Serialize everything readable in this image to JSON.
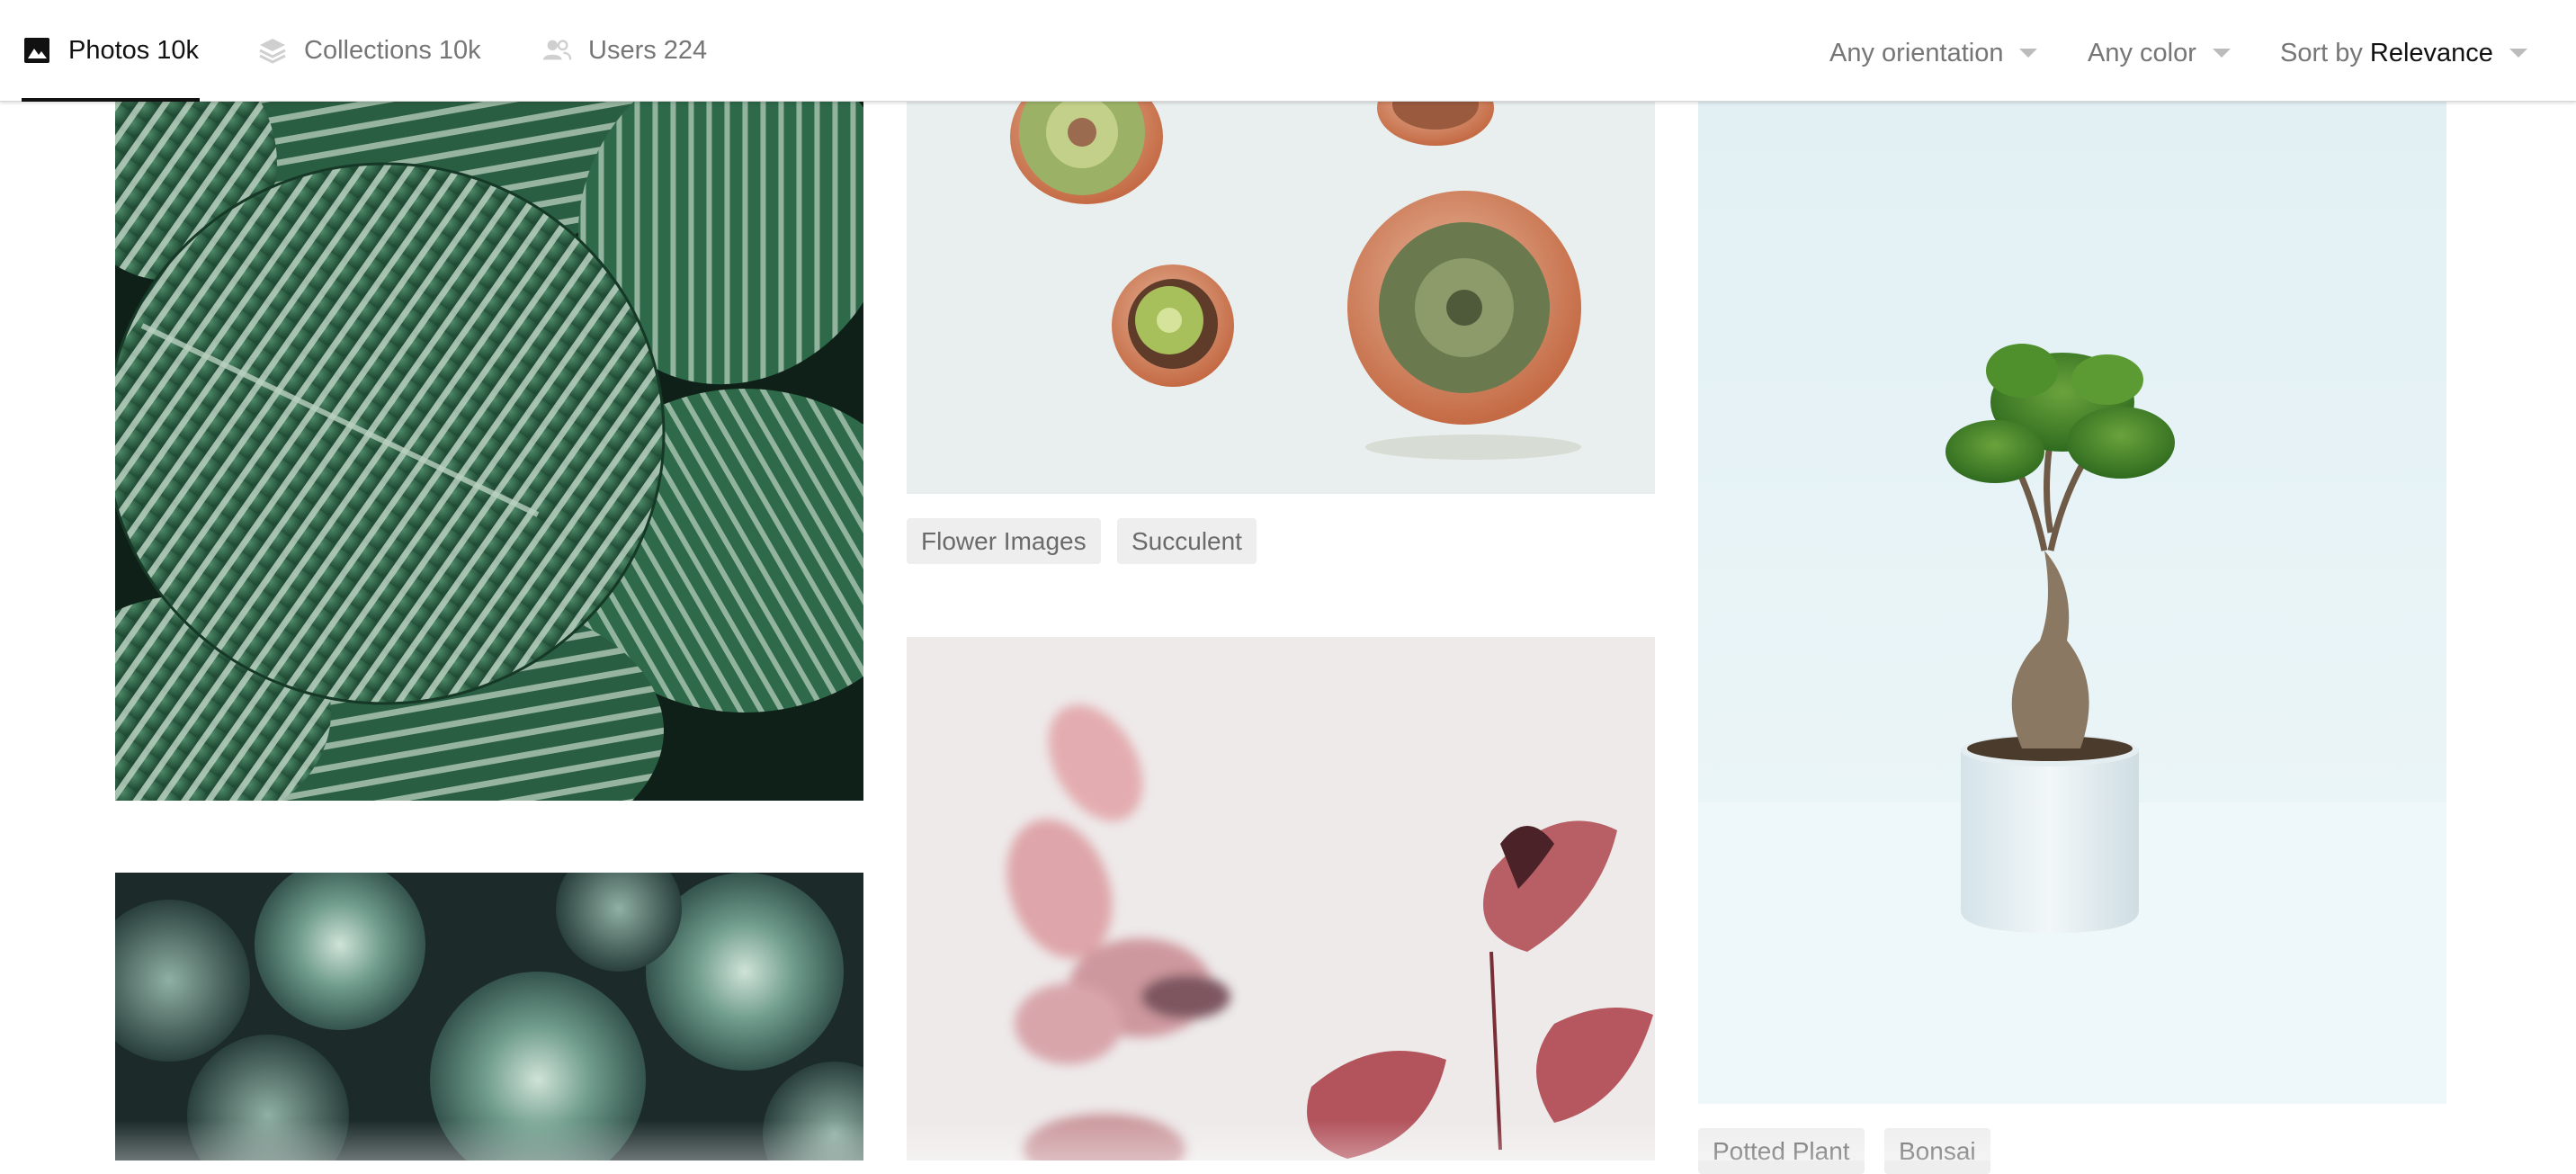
{
  "tabs": {
    "photos": {
      "label": "Photos",
      "count": "10k",
      "icon": "image-icon"
    },
    "collections": {
      "label": "Collections",
      "count": "10k",
      "icon": "layers-icon"
    },
    "users": {
      "label": "Users",
      "count": "224",
      "icon": "users-icon"
    }
  },
  "filters": {
    "orientation": "Any orientation",
    "color": "Any color",
    "sort_prefix": "Sort by",
    "sort_value": "Relevance"
  },
  "tags": {
    "succulent_photo": [
      "Flower Images",
      "Succulent"
    ],
    "bonsai_photo": [
      "Potted Plant",
      "Bonsai"
    ]
  },
  "colors": {
    "accent": "#111111",
    "muted": "#767676",
    "tag_bg": "#eeeeee"
  }
}
